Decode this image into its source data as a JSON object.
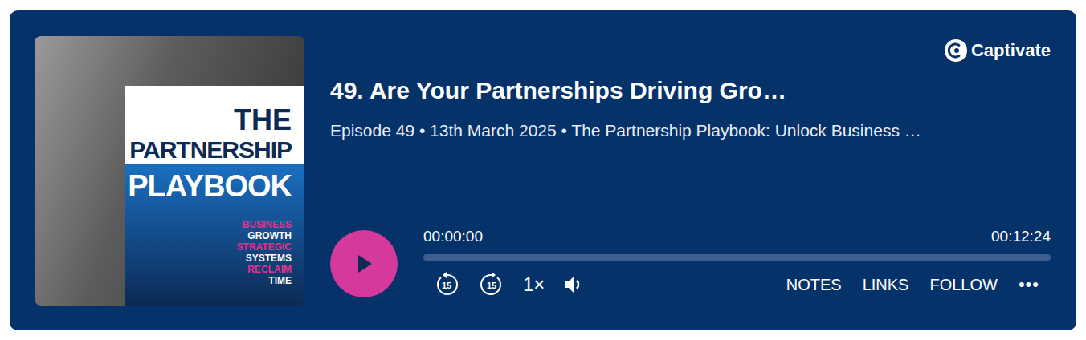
{
  "cover": {
    "lines": [
      "THE",
      "PARTNERSHIP",
      "PLAYBOOK"
    ],
    "tags": [
      {
        "label": "BUSINESS",
        "color": "#e0338f"
      },
      {
        "label": "GROWTH",
        "color": "#ffffff"
      },
      {
        "label": "STRATEGIC",
        "color": "#e0338f"
      },
      {
        "label": "SYSTEMS",
        "color": "#ffffff"
      },
      {
        "label": "RECLAIM",
        "color": "#e0338f"
      },
      {
        "label": "TIME",
        "color": "#ffffff"
      }
    ]
  },
  "brand": "Captivate",
  "episode": {
    "title": "49. Are Your Partnerships Driving Gro…",
    "meta": "Episode 49 • 13th March 2025 • The Partnership Playbook: Unlock Business …"
  },
  "player": {
    "playing": false,
    "elapsed": "00:00:00",
    "duration": "00:12:24",
    "level": 0,
    "rewind": "15",
    "forward": "15",
    "speed": "1×",
    "muted": false
  },
  "actions": [
    {
      "label": "NOTES"
    },
    {
      "label": "LINKS"
    },
    {
      "label": "FOLLOW"
    }
  ],
  "more": "•••"
}
